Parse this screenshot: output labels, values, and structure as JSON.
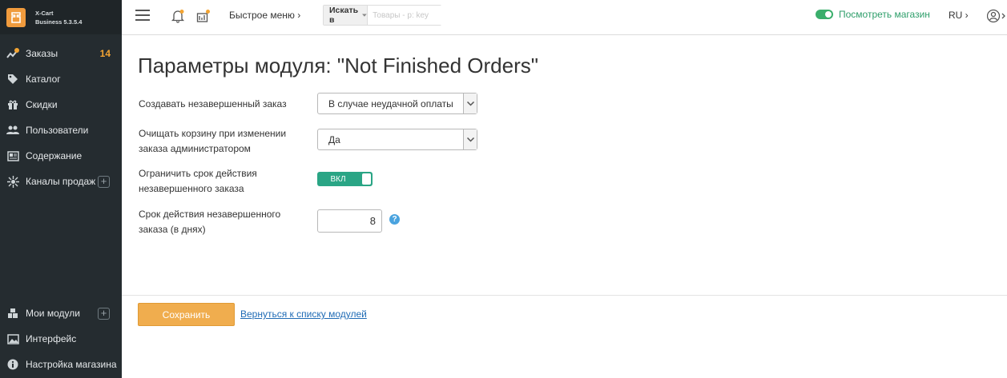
{
  "brand": {
    "line1": "X-Cart",
    "line2": "Business 5.3.5.4"
  },
  "sidebar": {
    "items": [
      {
        "label": "Заказы",
        "icon": "orders-icon",
        "count": "14"
      },
      {
        "label": "Каталог",
        "icon": "tag-icon"
      },
      {
        "label": "Скидки",
        "icon": "gift-icon"
      },
      {
        "label": "Пользователи",
        "icon": "users-icon"
      },
      {
        "label": "Содержание",
        "icon": "content-icon"
      },
      {
        "label": "Каналы продаж",
        "icon": "channels-icon",
        "plus": "+"
      }
    ],
    "bottom_items": [
      {
        "label": "Мои модули",
        "icon": "puzzle-icon",
        "plus": "+"
      },
      {
        "label": "Интерфейс",
        "icon": "image-icon"
      },
      {
        "label": "Настройка магазина",
        "icon": "info-icon"
      }
    ]
  },
  "header": {
    "quick_menu": "Быстрое меню ›",
    "search_scope": "Искать в",
    "search_placeholder": "Товары - p: key",
    "view_store": "Посмотреть магазин",
    "language": "RU ›"
  },
  "page": {
    "title": "Параметры модуля: \"Not Finished Orders\"",
    "fields": {
      "create_order_label": "Создавать незавершенный заказ",
      "create_order_value": "В случае неудачной оплаты",
      "clear_cart_label": "Очищать корзину при изменении заказа администратором",
      "clear_cart_value": "Да",
      "limit_label": "Ограничить срок действия незавершенного заказа",
      "limit_toggle": "ВКЛ",
      "ttl_label": "Срок действия незавершенного заказа (в днях)",
      "ttl_value": "8"
    },
    "save_label": "Сохранить",
    "back_link": "Вернуться к списку модулей"
  },
  "colors": {
    "sidebar_bg": "#252c30",
    "accent": "#f0ad4e",
    "toggle_on": "#2aa585",
    "count_badge": "#f3a432",
    "link": "#1f6bb5"
  }
}
